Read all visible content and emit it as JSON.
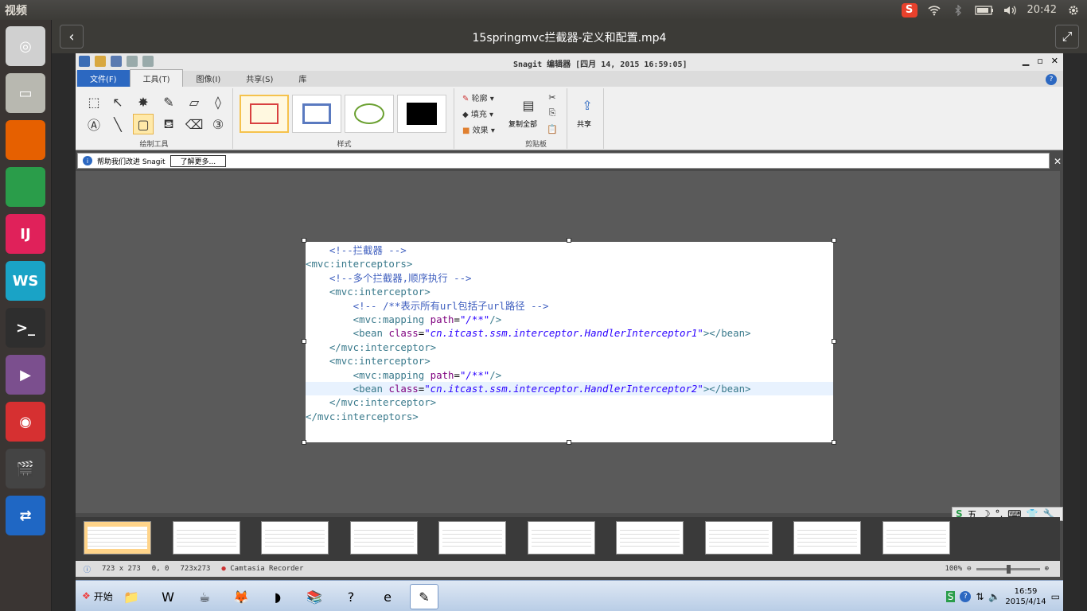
{
  "topbar": {
    "app_name": "视频",
    "clock": "20:42",
    "indicators": [
      "sogou-icon",
      "wifi-icon",
      "bluetooth-icon",
      "battery-icon",
      "volume-icon",
      "gear-icon"
    ],
    "sogou_glyph": "S"
  },
  "launcher": {
    "items": [
      {
        "name": "ubuntu-dash",
        "glyph": "◎",
        "color": "#d0d0d0"
      },
      {
        "name": "file-manager",
        "glyph": "▭",
        "color": "#b8b8b0"
      },
      {
        "name": "firefox",
        "glyph": "",
        "color": "#e66000"
      },
      {
        "name": "chrome",
        "glyph": "",
        "color": "#2a9d4a"
      },
      {
        "name": "intellij",
        "glyph": "IJ",
        "color": "#e0215a"
      },
      {
        "name": "webstorm",
        "glyph": "WS",
        "color": "#1aa3c6"
      },
      {
        "name": "terminal",
        "glyph": ">_",
        "color": "#2e2e2e"
      },
      {
        "name": "video-player",
        "glyph": "▶",
        "color": "#7b4f8e"
      },
      {
        "name": "netease-music",
        "glyph": "◉",
        "color": "#d63031"
      },
      {
        "name": "clapper",
        "glyph": "🎬",
        "color": "#444444"
      },
      {
        "name": "teamviewer",
        "glyph": "⇄",
        "color": "#1f67c4"
      }
    ]
  },
  "window": {
    "title": "15springmvc拦截器-定义和配置.mp4"
  },
  "snagit": {
    "title": "Snagit 编辑器 [四月 14, 2015 16:59:05]",
    "menu_tabs": [
      "文件(F)",
      "工具(T)",
      "图像(I)",
      "共享(S)",
      "库"
    ],
    "groups": {
      "draw_tools": "绘制工具",
      "styles": "样式",
      "clipboard": "剪贴板"
    },
    "props": {
      "outline": "轮廓",
      "fill": "填充",
      "effect": "效果"
    },
    "copy_all": "复制全部",
    "share": "共享",
    "infobar": {
      "text": "帮助我们改进 Snagit",
      "button": "了解更多..."
    },
    "code_lines": [
      [
        {
          "c": "cmt",
          "t": "    <!--拦截器 -->"
        }
      ],
      [
        {
          "c": "tag",
          "t": "<mvc:interceptors>"
        }
      ],
      [
        {
          "c": "cmt",
          "t": "    <!--多个拦截器,顺序执行 -->"
        }
      ],
      [
        {
          "c": "tag",
          "t": "    <mvc:interceptor>"
        }
      ],
      [
        {
          "c": "cmt",
          "t": "        <!-- /**表示所有url包括子url路径 -->"
        }
      ],
      [
        {
          "c": "tag",
          "t": "        <mvc:mapping "
        },
        {
          "c": "attr",
          "t": "path"
        },
        {
          "c": "plain",
          "t": "="
        },
        {
          "c": "str",
          "t": "\"/**\""
        },
        {
          "c": "tag",
          "t": "/>"
        }
      ],
      [
        {
          "c": "tag",
          "t": "        <bean "
        },
        {
          "c": "attr",
          "t": "class"
        },
        {
          "c": "plain",
          "t": "="
        },
        {
          "c": "str",
          "t": "\"cn.itcast.ssm.interceptor.HandlerInterceptor1\""
        },
        {
          "c": "tag",
          "t": "></bean>"
        }
      ],
      [
        {
          "c": "tag",
          "t": "    </mvc:interceptor>"
        }
      ],
      [
        {
          "c": "tag",
          "t": "    <mvc:interceptor>"
        }
      ],
      [
        {
          "c": "tag",
          "t": "        <mvc:mapping "
        },
        {
          "c": "attr",
          "t": "path"
        },
        {
          "c": "plain",
          "t": "="
        },
        {
          "c": "str",
          "t": "\"/**\""
        },
        {
          "c": "tag",
          "t": "/>"
        }
      ],
      [
        {
          "c": "tag",
          "t": "        <bean "
        },
        {
          "c": "attr",
          "t": "class"
        },
        {
          "c": "plain",
          "t": "="
        },
        {
          "c": "str",
          "t": "\"cn.itcast.ssm.interceptor.HandlerInterceptor2\""
        },
        {
          "c": "tag",
          "t": "></bean>"
        }
      ],
      [
        {
          "c": "tag",
          "t": "    </mvc:interceptor>"
        }
      ],
      [
        {
          "c": "tag",
          "t": "</mvc:interceptors>"
        }
      ]
    ],
    "highlight_line": 10,
    "status": {
      "size": "723 x 273",
      "pos": "0, 0",
      "sel": "723x273",
      "recorder": "Camtasia Recorder",
      "zoom": "100%"
    },
    "thumbnail_count": 10,
    "selected_thumbnail": 0,
    "tray_glyphs": [
      "S",
      "五",
      "☽",
      "°,",
      "⌨",
      "👕",
      "🔧"
    ]
  },
  "taskbar": {
    "start": "开始",
    "apps": [
      "explorer",
      "word",
      "javaee-ide",
      "firefox",
      "eclipse",
      "winrar",
      "help",
      "ie",
      "snagit"
    ],
    "app_glyphs": [
      "📁",
      "W",
      "☕",
      "🦊",
      "◗",
      "📚",
      "?",
      "e",
      "✎"
    ],
    "time": "16:59",
    "date": "2015/4/14"
  }
}
